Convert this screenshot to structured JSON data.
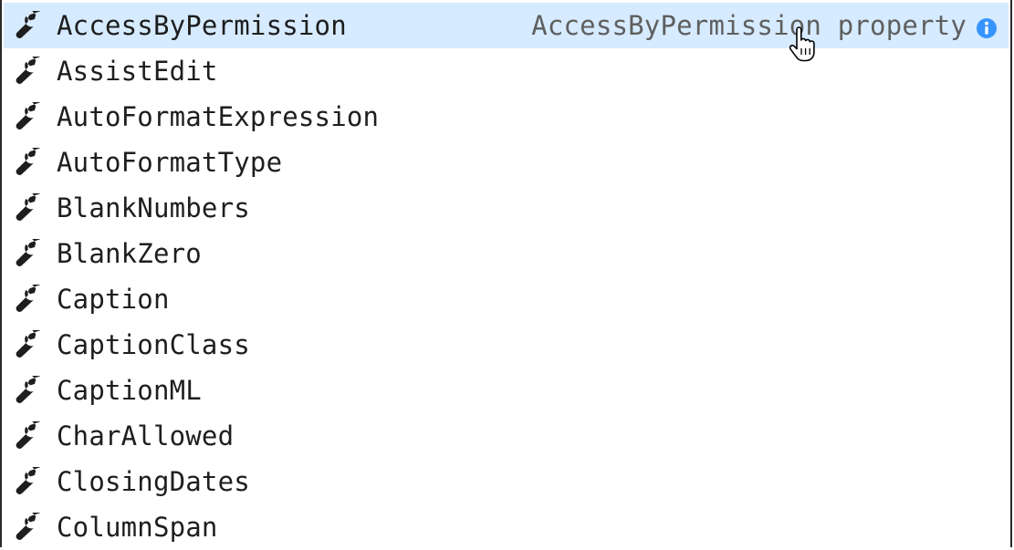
{
  "suggestions": {
    "items": [
      {
        "label": "AccessByPermission",
        "icon": "wrench-icon"
      },
      {
        "label": "AssistEdit",
        "icon": "wrench-icon"
      },
      {
        "label": "AutoFormatExpression",
        "icon": "wrench-icon"
      },
      {
        "label": "AutoFormatType",
        "icon": "wrench-icon"
      },
      {
        "label": "BlankNumbers",
        "icon": "wrench-icon"
      },
      {
        "label": "BlankZero",
        "icon": "wrench-icon"
      },
      {
        "label": "Caption",
        "icon": "wrench-icon"
      },
      {
        "label": "CaptionClass",
        "icon": "wrench-icon"
      },
      {
        "label": "CaptionML",
        "icon": "wrench-icon"
      },
      {
        "label": "CharAllowed",
        "icon": "wrench-icon"
      },
      {
        "label": "ClosingDates",
        "icon": "wrench-icon"
      },
      {
        "label": "ColumnSpan",
        "icon": "wrench-icon"
      }
    ],
    "selected_index": 0,
    "selected_detail": "AccessByPermission property",
    "info_icon": "info-icon",
    "cursor_icon": "hand-pointer-icon"
  },
  "colors": {
    "selected_background": "#d6ebff",
    "info_icon": "#3794ff",
    "text": "#1e1e1e",
    "detail_text": "#5f5f5f"
  }
}
